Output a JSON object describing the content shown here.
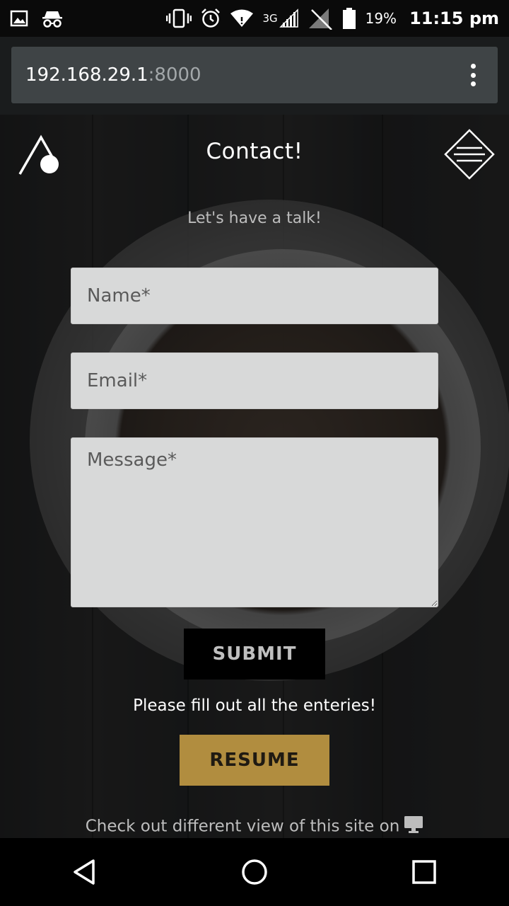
{
  "status_bar": {
    "signal_type": "3G",
    "battery_percent": "19%",
    "time": "11:15 pm"
  },
  "browser": {
    "url_host": "192.168.29.1",
    "url_port": ":8000"
  },
  "page": {
    "title": "Contact!",
    "subtitle": "Let's have a talk!",
    "form": {
      "name_placeholder": "Name*",
      "email_placeholder": "Email*",
      "message_placeholder": "Message*",
      "submit_label": "SUBMIT"
    },
    "form_note": "Please fill out all the enteries!",
    "resume_label": "RESUME",
    "footer_note": "Check out different view of this site on"
  },
  "colors": {
    "accent_gold": "#b18d3f",
    "field_bg": "#d8d9d9",
    "url_bar_bg": "#3f4446"
  }
}
